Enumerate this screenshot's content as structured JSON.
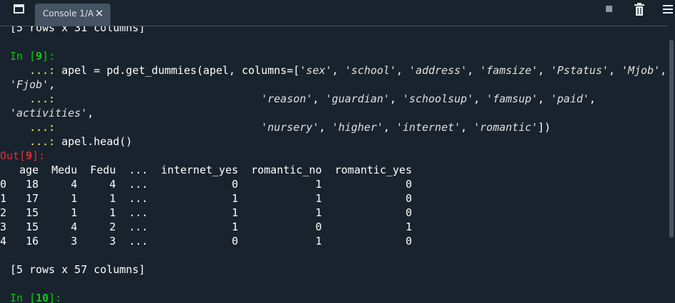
{
  "tab": {
    "label": "Console 1/A",
    "close": "✕"
  },
  "console": {
    "top_fragment": "[5 rows x 31 columns]",
    "in9": {
      "prompt_prefix": "In [",
      "prompt_num": "9",
      "prompt_suffix": "]:",
      "line1_code": "apel = pd.get_dummies(apel, columns=[",
      "line1_strings": [
        "'sex'",
        "'school'",
        "'address'",
        "'famsize'",
        "'Pstatus'",
        "'Mjob'"
      ],
      "line1_wrap": "'Fjob'",
      "line2_strings": [
        "'reason'",
        "'guardian'",
        "'schoolsup'",
        "'famsup'",
        "'paid'"
      ],
      "line2_wrap": "'activities'",
      "line3_strings": [
        "'nursery'",
        "'higher'",
        "'internet'",
        "'romantic'"
      ],
      "line3_close": "])",
      "line4_code": "apel.head()",
      "continuation": "...:"
    },
    "out9": {
      "prompt_prefix": "Out[",
      "prompt_num": "9",
      "prompt_suffix": "]:",
      "table_header": "   age  Medu  Fedu  ...  internet_yes  romantic_no  romantic_yes",
      "table_rows": [
        "0   18     4     4  ...             0            1             0",
        "1   17     1     1  ...             1            1             0",
        "2   15     1     1  ...             1            1             0",
        "3   15     4     2  ...             1            0             1",
        "4   16     3     3  ...             0            1             0"
      ],
      "summary": "[5 rows x 57 columns]"
    },
    "in10": {
      "prompt_prefix": "In [",
      "prompt_num": "10",
      "prompt_suffix": "]:"
    }
  }
}
